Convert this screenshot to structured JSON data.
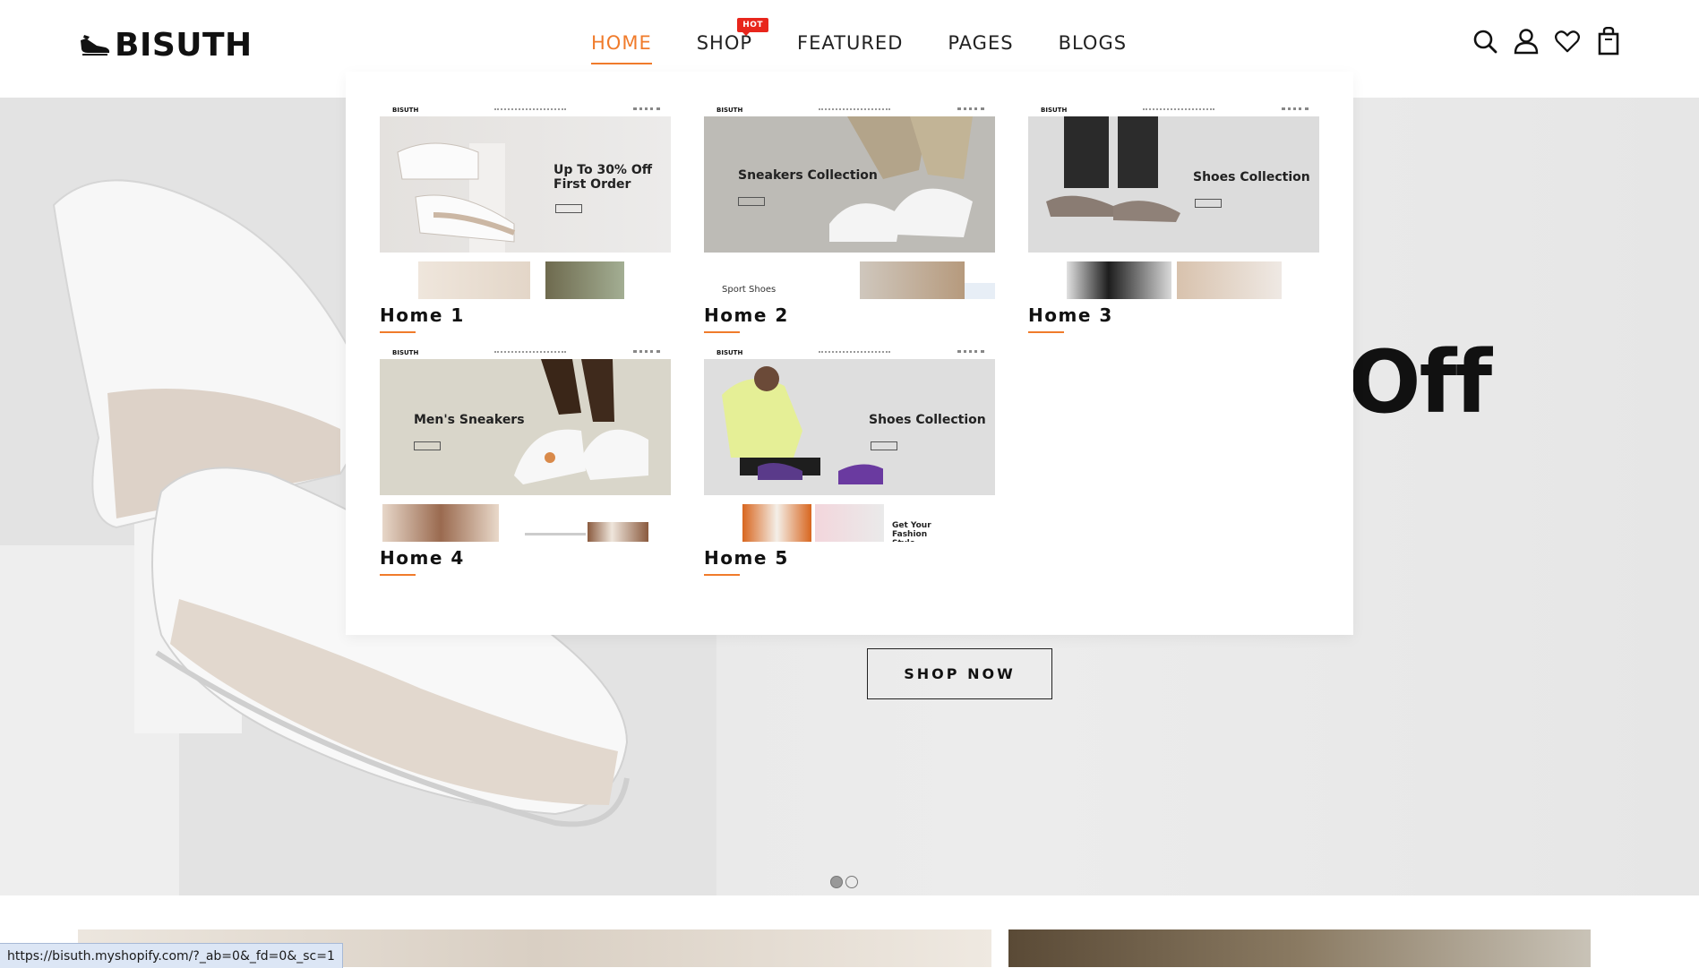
{
  "header": {
    "logo": "BISUTH",
    "nav": [
      {
        "label": "HOME",
        "active": true
      },
      {
        "label": "SHOP",
        "badge": "HOT"
      },
      {
        "label": "FEATURED"
      },
      {
        "label": "PAGES"
      },
      {
        "label": "BLOGS"
      }
    ],
    "icons": [
      "search-icon",
      "user-icon",
      "heart-icon",
      "shopping-bag-icon"
    ]
  },
  "mega_menu": {
    "demos": [
      {
        "label": "Home 1",
        "thumb": {
          "logo": "BISUTH",
          "lines": [
            "Up To 30% Off",
            "First Order"
          ]
        }
      },
      {
        "label": "Home 2",
        "thumb": {
          "logo": "BISUTH",
          "lines": [
            "Sneakers Collection"
          ],
          "caption": "Sport Shoes"
        }
      },
      {
        "label": "Home 3",
        "thumb": {
          "logo": "BISUTH",
          "lines": [
            "Shoes Collection"
          ]
        }
      },
      {
        "label": "Home 4",
        "thumb": {
          "logo": "BISUTH",
          "lines": [
            "Men's Sneakers"
          ]
        }
      },
      {
        "label": "Home 5",
        "thumb": {
          "logo": "BISUTH",
          "lines": [
            "Shoes Collection"
          ],
          "caption": "Get Your Fashion Style"
        }
      }
    ]
  },
  "hero": {
    "partial_heading": "Off",
    "cta": "SHOP NOW",
    "slides": 2,
    "active_slide": 1
  },
  "status_bar": {
    "url": "https://bisuth.myshopify.com/?_ab=0&_fd=0&_sc=1"
  },
  "colors": {
    "accent": "#f07b2b",
    "hot_badge": "#e8261c",
    "status_bar_bg": "#dce6f5"
  }
}
